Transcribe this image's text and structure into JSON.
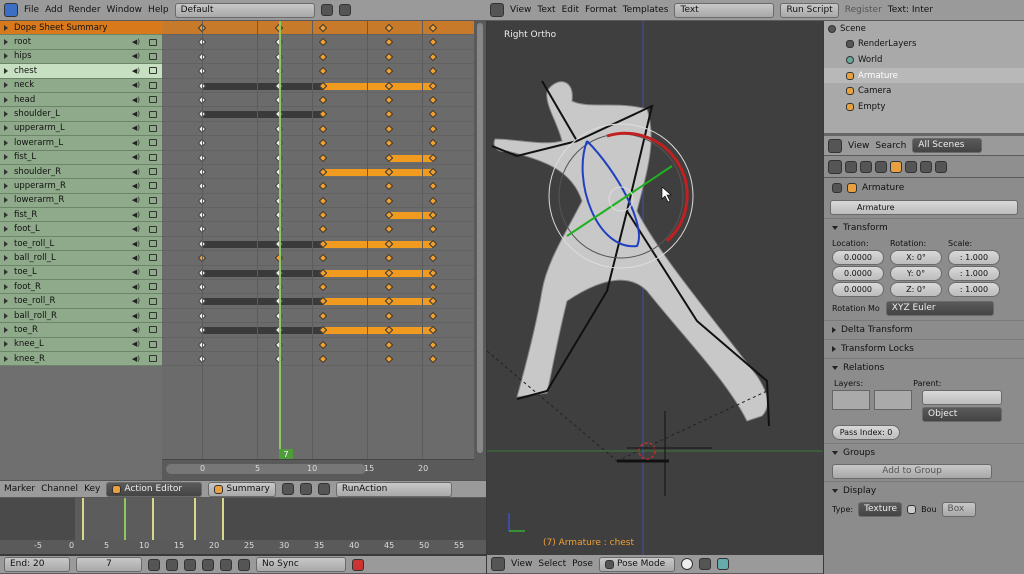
{
  "top_menu": {
    "items": [
      "File",
      "Add",
      "Render",
      "Window",
      "Help"
    ],
    "layout": "Default",
    "right_menu": [
      "View",
      "Text",
      "Edit",
      "Format",
      "Templates"
    ],
    "text_block": "Text",
    "run_script": "Run Script",
    "register": "Register",
    "tail": "Text: Inter"
  },
  "dope": {
    "channels": [
      {
        "name": "Dope Sheet Summary",
        "kind": "sum"
      },
      {
        "name": "root"
      },
      {
        "name": "hips"
      },
      {
        "name": "chest",
        "kind": "sel"
      },
      {
        "name": "neck"
      },
      {
        "name": "head"
      },
      {
        "name": "shoulder_L"
      },
      {
        "name": "upperarm_L"
      },
      {
        "name": "lowerarm_L"
      },
      {
        "name": "fist_L"
      },
      {
        "name": "shoulder_R"
      },
      {
        "name": "upperarm_R"
      },
      {
        "name": "lowerarm_R"
      },
      {
        "name": "fist_R"
      },
      {
        "name": "foot_L"
      },
      {
        "name": "toe_roll_L"
      },
      {
        "name": "ball_roll_L"
      },
      {
        "name": "toe_L"
      },
      {
        "name": "foot_R"
      },
      {
        "name": "toe_roll_R"
      },
      {
        "name": "ball_roll_R"
      },
      {
        "name": "toe_R"
      },
      {
        "name": "knee_L"
      },
      {
        "name": "knee_R"
      }
    ],
    "ruler": [
      "0",
      "5",
      "10",
      "15",
      "20"
    ],
    "current_frame": "7",
    "header": {
      "menus": [
        "Marker",
        "Channel",
        "Key"
      ],
      "mode": "Action Editor",
      "summary": "Summary",
      "action": "RunAction"
    }
  },
  "timeline": {
    "ruler": [
      "-5",
      "0",
      "5",
      "10",
      "15",
      "20",
      "25",
      "30",
      "35",
      "40",
      "45",
      "50",
      "55"
    ],
    "end": "End: 20",
    "frame": "7",
    "sync": "No Sync"
  },
  "viewport": {
    "label": "Right Ortho",
    "status": "(7) Armature : chest",
    "menus": [
      "View",
      "Select",
      "Pose"
    ],
    "mode": "Pose Mode"
  },
  "outliner": {
    "items": [
      "Scene",
      "RenderLayers",
      "World",
      "Armature",
      "Camera",
      "Empty"
    ]
  },
  "props": {
    "header_menus": [
      "View",
      "Search"
    ],
    "scenes": "All Scenes",
    "breadcrumb": "Armature",
    "object_name": "Armature",
    "transform": {
      "title": "Transform",
      "loc_label": "Location:",
      "rot_label": "Rotation:",
      "scale_label": "Scale:",
      "loc": [
        "0.0000",
        "0.0000",
        "0.0000"
      ],
      "rot": [
        "X: 0°",
        "Y: 0°",
        "Z: 0°"
      ],
      "scale": [
        ": 1.000",
        ": 1.000",
        ": 1.000"
      ],
      "rot_mode_label": "Rotation Mo",
      "rot_mode": "XYZ Euler"
    },
    "panels": [
      "Delta Transform",
      "Transform Locks"
    ],
    "relations": {
      "title": "Relations",
      "layers": "Layers:",
      "parent": "Parent:",
      "object": "Object",
      "pass_index": "Pass Index: 0"
    },
    "groups": {
      "title": "Groups",
      "add": "Add to Group"
    },
    "display": {
      "title": "Display",
      "type_label": "Type:",
      "type": "Texture",
      "bou": "Bou",
      "box": "Box"
    }
  }
}
